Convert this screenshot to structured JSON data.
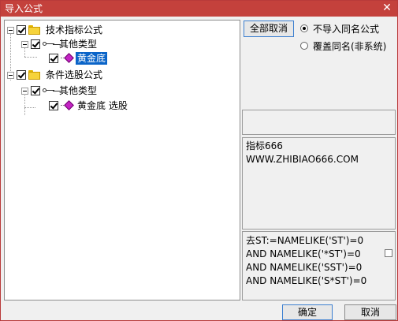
{
  "window": {
    "title": "导入公式",
    "close_glyph": "✕"
  },
  "tree": {
    "groups": [
      {
        "label": "技术指标公式",
        "checked": true,
        "category": {
          "label": "其他类型",
          "checked": true
        },
        "item": {
          "label": "黄金底",
          "checked": true,
          "selected": true
        }
      },
      {
        "label": "条件选股公式",
        "checked": true,
        "category": {
          "label": "其他类型",
          "checked": true
        },
        "item": {
          "label": "黄金底 选股",
          "checked": true,
          "selected": false
        }
      }
    ]
  },
  "actions": {
    "deselect_all": "全部取消",
    "ok": "确定",
    "cancel": "取消"
  },
  "options": [
    {
      "label": "不导入同名公式",
      "checked": true
    },
    {
      "label": "覆盖同名(非系统)",
      "checked": false
    }
  ],
  "description": {
    "line1": "指标666",
    "line2": "WWW.ZHIBIAO666.COM"
  },
  "condition": {
    "lines": [
      "去ST:=NAMELIKE('ST')=0",
      "AND NAMELIKE('*ST')=0",
      "AND NAMELIKE('SST')=0",
      "AND NAMELIKE('S*ST')=0"
    ],
    "checked": false
  }
}
